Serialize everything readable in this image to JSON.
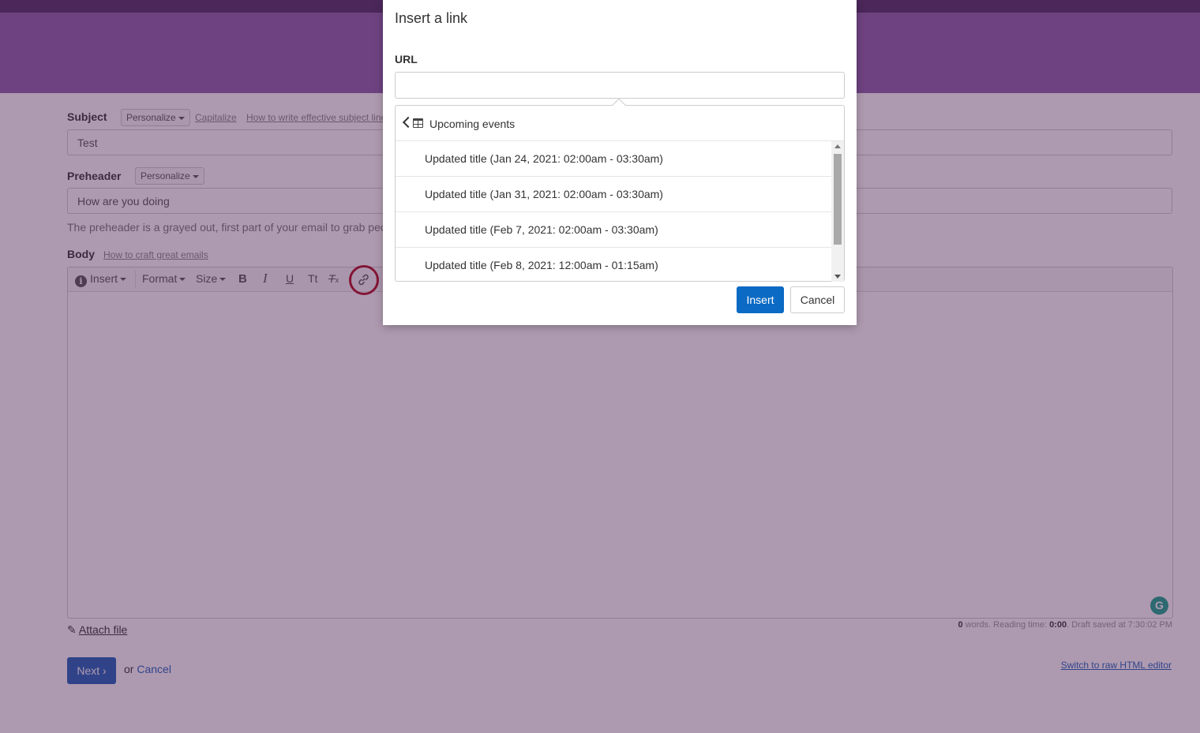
{
  "form": {
    "subject_label": "Subject",
    "subject_personalize": "Personalize",
    "capitalize_link": "Capitalize",
    "subject_help_link": "How to write effective subject lines",
    "subject_value": "Test",
    "preheader_label": "Preheader",
    "preheader_personalize": "Personalize",
    "preheader_value": "How are you doing",
    "preheader_help": "The preheader is a grayed out, first part of your email to grab people's attention",
    "body_label": "Body",
    "body_help_link": "How to craft great emails"
  },
  "toolbar": {
    "insert": "Insert",
    "format": "Format",
    "size": "Size",
    "bold": "B",
    "italic": "I",
    "underline": "U",
    "text_case": "Tt",
    "clear_format": "T",
    "clear_sub": "x"
  },
  "footer": {
    "attach_file": "Attach file",
    "word_count": "0",
    "words_text": " words. Reading time: ",
    "reading_time": "0:00",
    "draft_saved": ". Draft saved at 7:30:02 PM",
    "next_button": "Next ›",
    "or_text": "or ",
    "cancel_link": "Cancel",
    "raw_html_link": "Switch to raw HTML editor"
  },
  "modal": {
    "title": "Insert a link",
    "url_label": "URL",
    "url_value": "",
    "dropdown_header": "Upcoming events",
    "events": [
      "Updated title (Jan 24, 2021: 02:00am - 03:30am)",
      "Updated title (Jan 31, 2021: 02:00am - 03:30am)",
      "Updated title (Feb 7, 2021: 02:00am - 03:30am)",
      "Updated title (Feb 8, 2021: 12:00am - 01:15am)"
    ],
    "insert_button": "Insert",
    "cancel_button": "Cancel"
  },
  "colors": {
    "primary_button": "#0a6ac4",
    "header_bar": "#4b2f63",
    "highlight_ring": "#b10d1d"
  }
}
